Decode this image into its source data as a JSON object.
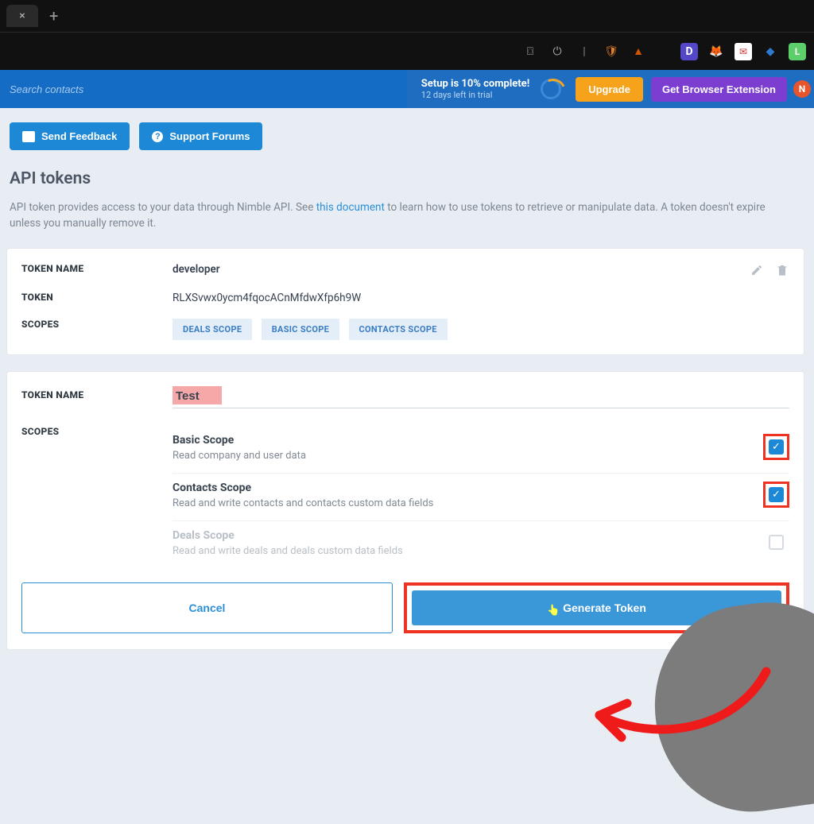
{
  "topbar": {
    "search_placeholder": "Search contacts",
    "setup_title": "Setup is 10% complete!",
    "setup_sub": "12 days left in trial",
    "upgrade_label": "Upgrade",
    "extension_label": "Get Browser Extension",
    "badge_letter": "N"
  },
  "actions": {
    "feedback_label": "Send Feedback",
    "forums_label": "Support Forums"
  },
  "page": {
    "title": "API tokens",
    "desc_pre": "API token provides access to your data through Nimble API. See ",
    "desc_link": "this document",
    "desc_post": " to learn how to use tokens to retrieve or manipulate data. A token doesn't expire unless you manually remove it."
  },
  "labels": {
    "token_name": "TOKEN NAME",
    "token": "TOKEN",
    "scopes": "SCOPES"
  },
  "existing": {
    "name": "developer",
    "token": "RLXSvwx0ycm4fqocACnMfdwXfp6h9W",
    "scopes": [
      "DEALS SCOPE",
      "BASIC SCOPE",
      "CONTACTS SCOPE"
    ]
  },
  "form": {
    "name_value": "Test",
    "scopes": [
      {
        "title": "Basic Scope",
        "desc": "Read company and user data",
        "checked": true,
        "highlight": true,
        "disabled": false
      },
      {
        "title": "Contacts Scope",
        "desc": "Read and write contacts and contacts custom data fields",
        "checked": true,
        "highlight": true,
        "disabled": false
      },
      {
        "title": "Deals Scope",
        "desc": "Read and write deals and deals custom data fields",
        "checked": false,
        "highlight": false,
        "disabled": true
      }
    ],
    "cancel_label": "Cancel",
    "generate_label": "Generate Token"
  }
}
